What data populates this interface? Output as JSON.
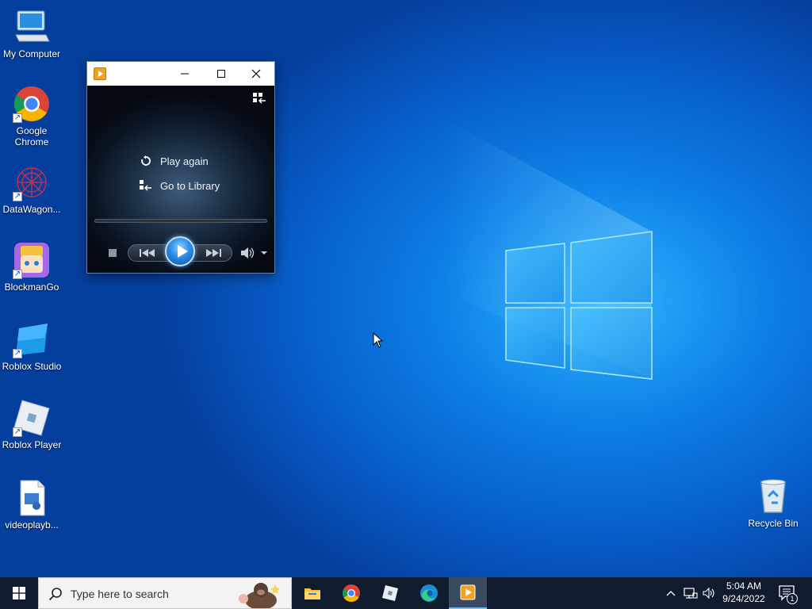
{
  "desktop": {
    "icons": [
      {
        "label": "My Computer",
        "icon": "computer-icon"
      },
      {
        "label": "Google Chrome",
        "icon": "chrome-icon"
      },
      {
        "label": "DataWagon...",
        "icon": "datawagon-icon"
      },
      {
        "label": "BlockmanGo",
        "icon": "blockmango-icon"
      },
      {
        "label": "Roblox Studio",
        "icon": "roblox-studio-icon"
      },
      {
        "label": "Roblox Player",
        "icon": "roblox-player-icon"
      },
      {
        "label": "videoplayb...",
        "icon": "video-file-icon"
      },
      {
        "label": "Recycle Bin",
        "icon": "recycle-bin-icon"
      }
    ]
  },
  "player": {
    "menu": {
      "play_again": "Play again",
      "go_to_library": "Go to Library"
    }
  },
  "taskbar": {
    "search_placeholder": "Type here to search",
    "apps": [
      "file-explorer-icon",
      "chrome-icon",
      "roblox-icon",
      "edge-icon",
      "media-player-icon"
    ],
    "clock": {
      "time": "5:04 AM",
      "date": "9/24/2022"
    },
    "notification_count": "1"
  },
  "colors": {
    "wallpaper": "#0d7fe6",
    "taskbar": "#101c2e",
    "accent": "#76b9ed"
  }
}
